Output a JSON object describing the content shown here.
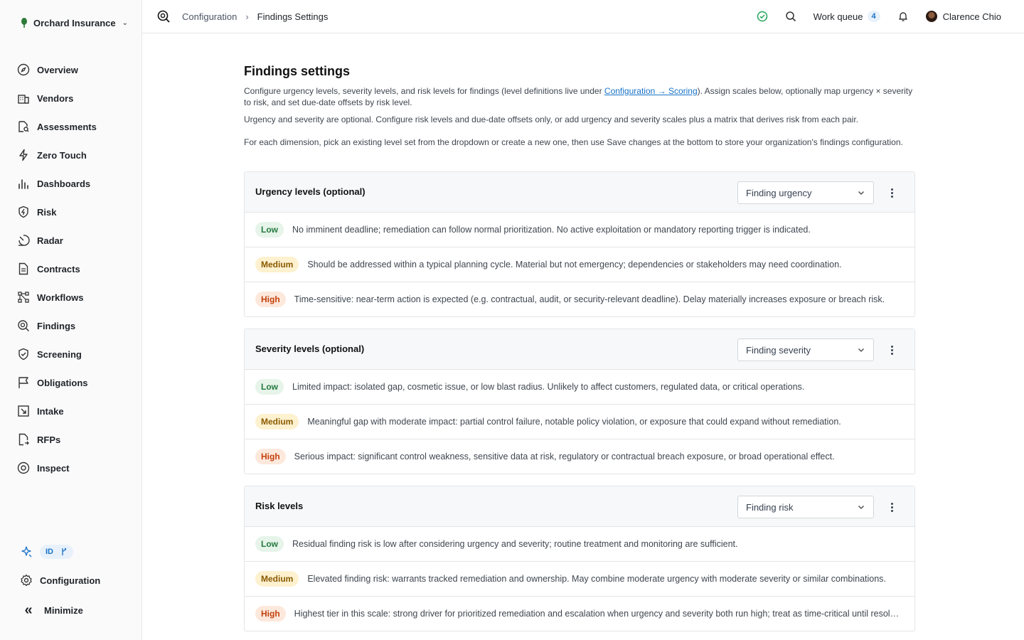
{
  "org": {
    "name": "Orchard Insurance"
  },
  "nav": [
    {
      "label": "Overview",
      "icon": "compass-icon"
    },
    {
      "label": "Vendors",
      "icon": "building-icon"
    },
    {
      "label": "Assessments",
      "icon": "file-search-icon"
    },
    {
      "label": "Zero Touch",
      "icon": "bolt-icon"
    },
    {
      "label": "Dashboards",
      "icon": "bar-chart-icon"
    },
    {
      "label": "Risk",
      "icon": "shield-bolt-icon"
    },
    {
      "label": "Radar",
      "icon": "radar-icon"
    },
    {
      "label": "Contracts",
      "icon": "document-icon"
    },
    {
      "label": "Workflows",
      "icon": "workflow-icon"
    },
    {
      "label": "Findings",
      "icon": "magnifier-icon"
    },
    {
      "label": "Screening",
      "icon": "shield-check-icon"
    },
    {
      "label": "Obligations",
      "icon": "flag-icon"
    },
    {
      "label": "Intake",
      "icon": "intake-icon"
    },
    {
      "label": "RFPs",
      "icon": "file-arrow-icon"
    },
    {
      "label": "Inspect",
      "icon": "eye-icon"
    }
  ],
  "sidebar_bottom": {
    "id_badge": "ID",
    "configuration": "Configuration",
    "minimize": "Minimize"
  },
  "header": {
    "breadcrumb_parent": "Configuration",
    "breadcrumb_current": "Findings Settings",
    "work_queue_label": "Work queue",
    "work_queue_count": "4",
    "user_name": "Clarence Chio"
  },
  "page": {
    "title": "Findings settings",
    "desc1_before": "Configure urgency levels, severity levels, and risk levels for findings (level definitions live under ",
    "desc1_link": "Configuration → Scoring",
    "desc1_after": "). Assign scales below, optionally map urgency × severity to risk, and set due-date offsets by risk level.",
    "desc2": "Urgency and severity are optional. Configure risk levels and due-date offsets only, or add urgency and severity scales plus a matrix that derives risk from each pair.",
    "desc3": "For each dimension, pick an existing level set from the dropdown or create a new one, then use Save changes at the bottom to store your organization's findings configuration."
  },
  "cards": [
    {
      "title": "Urgency levels (optional)",
      "selected": "Finding urgency",
      "levels": [
        {
          "level": "Low",
          "text": "No imminent deadline; remediation can follow normal prioritization. No active exploitation or mandatory reporting trigger is indicated."
        },
        {
          "level": "Medium",
          "text": "Should be addressed within a typical planning cycle. Material but not emergency; dependencies or stakeholders may need coordination."
        },
        {
          "level": "High",
          "text": "Time-sensitive: near-term action is expected (e.g. contractual, audit, or security-relevant deadline). Delay materially increases exposure or breach risk."
        }
      ]
    },
    {
      "title": "Severity levels (optional)",
      "selected": "Finding severity",
      "levels": [
        {
          "level": "Low",
          "text": "Limited impact: isolated gap, cosmetic issue, or low blast radius. Unlikely to affect customers, regulated data, or critical operations."
        },
        {
          "level": "Medium",
          "text": "Meaningful gap with moderate impact: partial control failure, notable policy violation, or exposure that could expand without remediation."
        },
        {
          "level": "High",
          "text": "Serious impact: significant control weakness, sensitive data at risk, regulatory or contractual breach exposure, or broad operational effect."
        }
      ]
    },
    {
      "title": "Risk levels",
      "selected": "Finding risk",
      "levels": [
        {
          "level": "Low",
          "text": "Residual finding risk is low after considering urgency and severity; routine treatment and monitoring are sufficient."
        },
        {
          "level": "Medium",
          "text": "Elevated finding risk: warrants tracked remediation and ownership. May combine moderate urgency with moderate severity or similar combinations."
        },
        {
          "level": "High",
          "text": "Highest tier in this scale: strong driver for prioritized remediation and escalation when urgency and severity both run high; treat as time-critical until resolved."
        }
      ]
    }
  ],
  "colors": {
    "accent": "#1a73c7",
    "status_ok": "#22a55a",
    "low": "#257a3e",
    "medium": "#8a5a00",
    "high": "#c2410c"
  }
}
